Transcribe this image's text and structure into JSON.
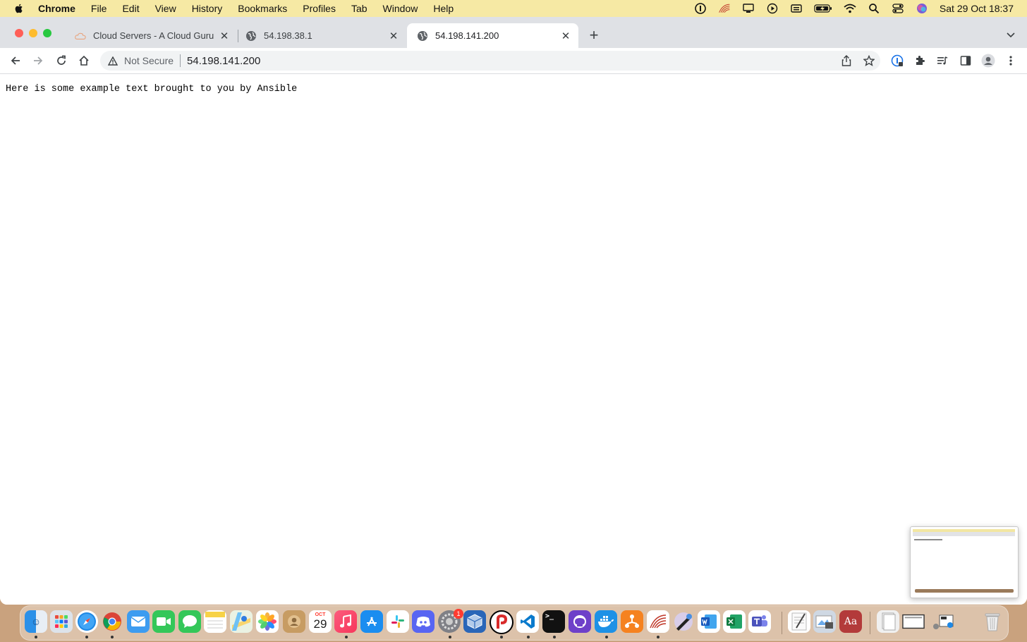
{
  "menubar": {
    "app_name": "Chrome",
    "items": [
      "File",
      "Edit",
      "View",
      "History",
      "Bookmarks",
      "Profiles",
      "Tab",
      "Window",
      "Help"
    ],
    "clock": "Sat 29 Oct  18:37",
    "bg_color": "#f6e9a4"
  },
  "tabs": [
    {
      "title": "Cloud Servers - A Cloud Guru",
      "favicon": "cloud-icon",
      "active": false
    },
    {
      "title": "54.198.38.1",
      "favicon": "globe-icon",
      "active": false
    },
    {
      "title": "54.198.141.200",
      "favicon": "globe-icon",
      "active": true
    }
  ],
  "omnibox": {
    "security_label": "Not Secure",
    "url": "54.198.141.200"
  },
  "page": {
    "text": "Here is some example text brought to you by Ansible"
  },
  "dock": {
    "calendar_month": "OCT",
    "calendar_day": "29",
    "settings_badge": "1",
    "dictionary_label": "Aa"
  }
}
